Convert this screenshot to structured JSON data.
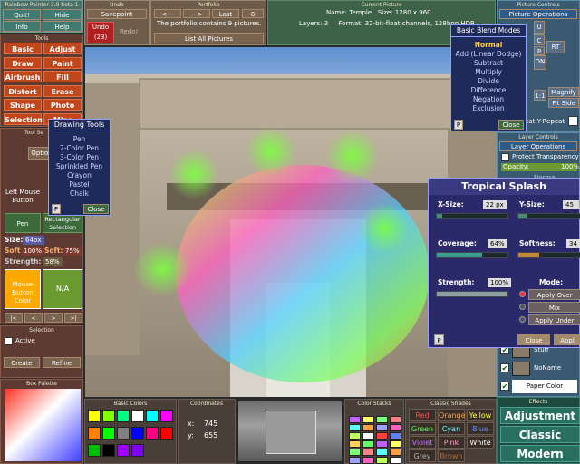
{
  "app": {
    "title": "Rainbow Painter 3.0 beta 1",
    "quit": "Quit!",
    "hide": "Hide",
    "info": "Info",
    "help": "Help"
  },
  "undo": {
    "title": "Undo",
    "savepoint": "Savepoint",
    "undo_label": "Undo (23)",
    "redo": "Redo!"
  },
  "portfolio": {
    "title": "Portfolio",
    "prev": "<---",
    "next": "--->",
    "last": "Last",
    "slot": "8",
    "message": "The portfolio contains 9 pictures.",
    "list": "List All Pictures"
  },
  "current": {
    "title": "Current Picture",
    "name_label": "Name:",
    "name": "Temple",
    "size_label": "Size:",
    "size": "1280 x 960",
    "layers_label": "Layers:",
    "layers": "3",
    "format_label": "Format:",
    "format": "32-bit-float channels, 128bpp",
    "hdr": "HDR"
  },
  "picture_controls": {
    "title": "Picture Controls",
    "ops": "Picture Operations",
    "nav": {
      "up": "U",
      "left": "L",
      "center": "C",
      "rt": "RT",
      "down": "DN",
      "pd": "P"
    },
    "magnify": "Magnify",
    "fit_side": "Fit Side",
    "ratio": "1:1",
    "repeat": "eat Y-Repeat"
  },
  "tools": {
    "title": "Tools",
    "items": [
      "Basic",
      "Adjust",
      "Draw",
      "Paint",
      "Airbrush",
      "Fill",
      "Distort",
      "Erase",
      "Shape",
      "Photo",
      "Selection",
      "Misc"
    ]
  },
  "tool_settings": {
    "title": "Tool Se",
    "options": "Option",
    "left_mouse": "Left Mouse Button",
    "pen": "Pen",
    "rect_sel": "Rectangular Selection",
    "size_label": "Size:",
    "size": "64px",
    "soft_label": "Soft:",
    "soft": "100%",
    "soft2_label": "Soft:",
    "soft2": "75%",
    "strength_label": "Strength:",
    "strength": "58%",
    "mouse_color": "Mouse Button Color",
    "na": "N/A",
    "pagination": [
      "|<",
      "<",
      ">",
      ">|"
    ]
  },
  "drawing_tools": {
    "title": "Drawing Tools",
    "items": [
      "Pen",
      "2-Color Pen",
      "3-Color Pen",
      "Sprinkled Pen",
      "Crayon",
      "Pastel",
      "Chalk"
    ],
    "close": "Close",
    "p": "P"
  },
  "blend_modes": {
    "title": "Basic Blend Modes",
    "items": [
      "Normal",
      "Add (Linear Dodge)",
      "Subtract",
      "Multiply",
      "Divide",
      "Difference",
      "Negation",
      "Exclusion"
    ],
    "close": "Close",
    "p": "P"
  },
  "layer_controls": {
    "title": "Layer Controls",
    "ops": "Layer Operations",
    "protect": "Protect Transparency",
    "opacity_label": "Opacity:",
    "opacity": "100%",
    "normal": "Normal"
  },
  "tropical": {
    "title": "Tropical Splash",
    "xsize_label": "X-Size:",
    "xsize": "22 px",
    "ysize_label": "Y-Size:",
    "ysize": "45 p",
    "coverage_label": "Coverage:",
    "coverage": "64%",
    "coverage_frac": 0.64,
    "softness_label": "Softness:",
    "softness": "34",
    "softness_frac": 0.34,
    "strength_label": "Strength:",
    "strength": "100%",
    "strength_frac": 1.0,
    "mode_label": "Mode:",
    "modes": [
      "Apply Over",
      "Mix",
      "Apply Under"
    ],
    "close": "Close",
    "apply": "Appl",
    "p": "P"
  },
  "layers": {
    "items": [
      "Stuff",
      "NoName",
      "Paper Color"
    ]
  },
  "selection": {
    "title": "Selection",
    "active": "Active",
    "create": "Create",
    "refine": "Refine"
  },
  "box_palette": {
    "title": "Box Palette"
  },
  "basic_colors": {
    "title": "Basic Colors",
    "colors": [
      "#ffff00",
      "#80ff00",
      "#00ff80",
      "#ffffff",
      "#00ffff",
      "#ff00ff",
      "#ff8000",
      "#00ff00",
      "#808080",
      "#0000ff",
      "#ff0080",
      "#ff0000",
      "#00c000",
      "#000000",
      "#a000ff",
      "#8000ff"
    ]
  },
  "coordinates": {
    "title": "Coordinates",
    "x_label": "x:",
    "x": "745",
    "y_label": "y:",
    "y": "655"
  },
  "color_stacks": {
    "title": "Color Stacks"
  },
  "classic_shades": {
    "title": "Classic Shades",
    "items": [
      {
        "name": "Red",
        "color": "#ff4a4a"
      },
      {
        "name": "Orange",
        "color": "#ffa040"
      },
      {
        "name": "Yellow",
        "color": "#ffff40"
      },
      {
        "name": "Green",
        "color": "#50ff50"
      },
      {
        "name": "Cyan",
        "color": "#60ffff"
      },
      {
        "name": "Blue",
        "color": "#6090ff"
      },
      {
        "name": "Violet",
        "color": "#c070ff"
      },
      {
        "name": "Pink",
        "color": "#ffa0d0"
      },
      {
        "name": "White",
        "color": "#ffffff"
      },
      {
        "name": "Grey",
        "color": "#b0b0b0"
      },
      {
        "name": "Brown",
        "color": "#b07040"
      }
    ]
  },
  "effects": {
    "title": "Effects",
    "items": [
      "Adjustment",
      "Classic",
      "Modern"
    ]
  }
}
